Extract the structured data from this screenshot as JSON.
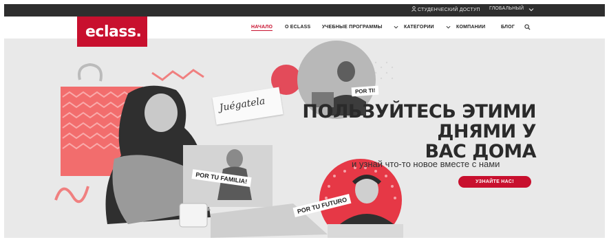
{
  "topbar": {
    "student_access": "СТУДЕНЧЕСКИЙ ДОСТУП",
    "global": "ГЛОБАЛЬНЫЙ"
  },
  "nav": {
    "logo": "eclass.",
    "links": [
      "НАЧАЛО",
      "О ECLASS",
      "УЧЕБНЫЕ ПРОГРАММЫ",
      "КАТЕГОРИИ",
      "КОМПАНИИ",
      "БЛОГ"
    ]
  },
  "hero": {
    "headline": [
      "ПОЛЬЗУЙТЕСЬ ЭТИМИ",
      "ДНЯМИ У",
      "ВАС ДОМА"
    ],
    "subline": "и узнай что-то новое вместе с нами",
    "cta": "УЗНАЙТЕ НАС!",
    "labels": {
      "por_ti": "POR TI!",
      "familia": "POR TU FAMILIA!",
      "futuro": "POR TU FUTURO",
      "handnote": "Juégatela"
    }
  },
  "colors": {
    "brand": "#c8102e",
    "topbar": "#2e2e2e"
  }
}
